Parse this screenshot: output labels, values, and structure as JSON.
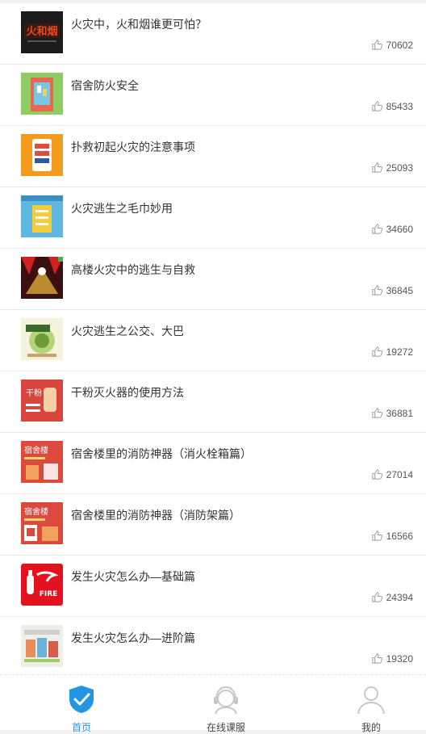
{
  "items": [
    {
      "title": "火灾中，火和烟谁更可怕？",
      "likes": "70602",
      "thumb_text": "火和烟"
    },
    {
      "title": "宿舍防火安全",
      "likes": "85433",
      "thumb_text": ""
    },
    {
      "title": "扑救初起火灾的注意事项",
      "likes": "25093",
      "thumb_text": ""
    },
    {
      "title": "火灾逃生之毛巾妙用",
      "likes": "34660",
      "thumb_text": ""
    },
    {
      "title": "高楼火灾中的逃生与自救",
      "likes": "36845",
      "thumb_text": ""
    },
    {
      "title": "火灾逃生之公交、大巴",
      "likes": "19272",
      "thumb_text": ""
    },
    {
      "title": "干粉灭火器的使用方法",
      "likes": "36881",
      "thumb_text": "干粉"
    },
    {
      "title": "宿舍楼里的消防神器（消火栓箱篇）",
      "likes": "27014",
      "thumb_text": "宿舍楼"
    },
    {
      "title": "宿舍楼里的消防神器（消防架篇）",
      "likes": "16566",
      "thumb_text": "宿舍楼"
    },
    {
      "title": "发生火灾怎么办—基础篇",
      "likes": "24394",
      "thumb_text": "FIRE"
    },
    {
      "title": "发生火灾怎么办—进阶篇",
      "likes": "19320",
      "thumb_text": ""
    }
  ],
  "tabs": [
    {
      "label": "首页",
      "icon": "shield-check-icon",
      "active": true
    },
    {
      "label": "在线课服",
      "icon": "headset-icon",
      "active": false
    },
    {
      "label": "我的",
      "icon": "user-icon",
      "active": false
    }
  ],
  "colors": {
    "accent": "#2296e0",
    "like_icon": "#999999"
  }
}
